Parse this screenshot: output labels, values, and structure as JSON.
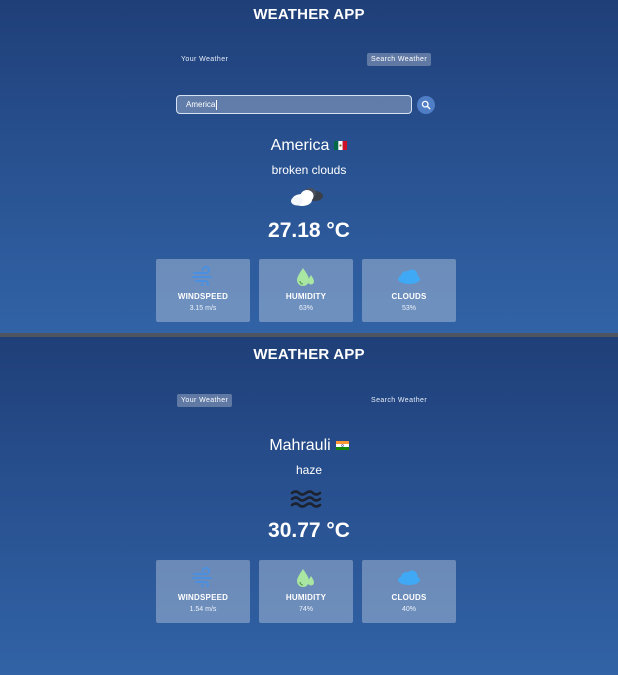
{
  "screens": [
    {
      "app_title": "WEATHER APP",
      "tabs": {
        "your_weather": "Your Weather",
        "search_weather": "Search Weather",
        "active": "search_weather"
      },
      "search": {
        "value": "America"
      },
      "city": "America",
      "flag_icon": "mexico-flag-icon",
      "description": "broken clouds",
      "weather_icon": "broken-clouds-icon",
      "temperature": "27.18 °C",
      "cards": [
        {
          "label": "WINDSPEED",
          "value": "3.15 m/s",
          "icon": "wind-icon"
        },
        {
          "label": "HUMIDITY",
          "value": "63%",
          "icon": "humidity-icon"
        },
        {
          "label": "CLOUDS",
          "value": "53%",
          "icon": "cloud-icon"
        }
      ]
    },
    {
      "app_title": "WEATHER APP",
      "tabs": {
        "your_weather": "Your Weather",
        "search_weather": "Search Weather",
        "active": "your_weather"
      },
      "city": "Mahrauli",
      "flag_icon": "india-flag-icon",
      "description": "haze",
      "weather_icon": "haze-icon",
      "temperature": "30.77 °C",
      "cards": [
        {
          "label": "WINDSPEED",
          "value": "1.54 m/s",
          "icon": "wind-icon"
        },
        {
          "label": "HUMIDITY",
          "value": "74%",
          "icon": "humidity-icon"
        },
        {
          "label": "CLOUDS",
          "value": "40%",
          "icon": "cloud-icon"
        }
      ]
    }
  ],
  "colors": {
    "background_top": "#1f3f78",
    "background_bottom": "#3163a6",
    "wind_icon": "#4a90e2",
    "humidity_icon": "#a8e6a1",
    "cloud_icon": "#3fa9f5"
  }
}
